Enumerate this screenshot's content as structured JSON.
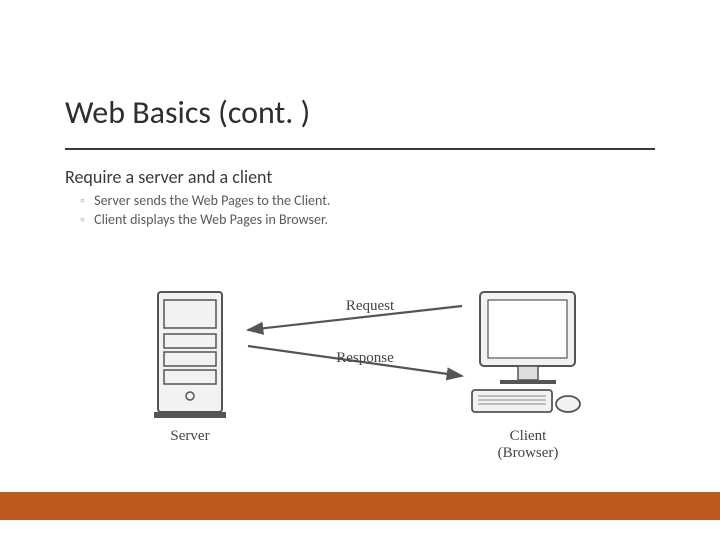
{
  "title": "Web Basics (cont. )",
  "subtitle": "Require a server and a client",
  "bullets": [
    "Server sends the Web Pages to the Client.",
    "Client displays the Web Pages in Browser."
  ],
  "diagram": {
    "server_label": "Server",
    "client_label_line1": "Client",
    "client_label_line2": "(Browser)",
    "request_label": "Request",
    "response_label": "Response"
  }
}
